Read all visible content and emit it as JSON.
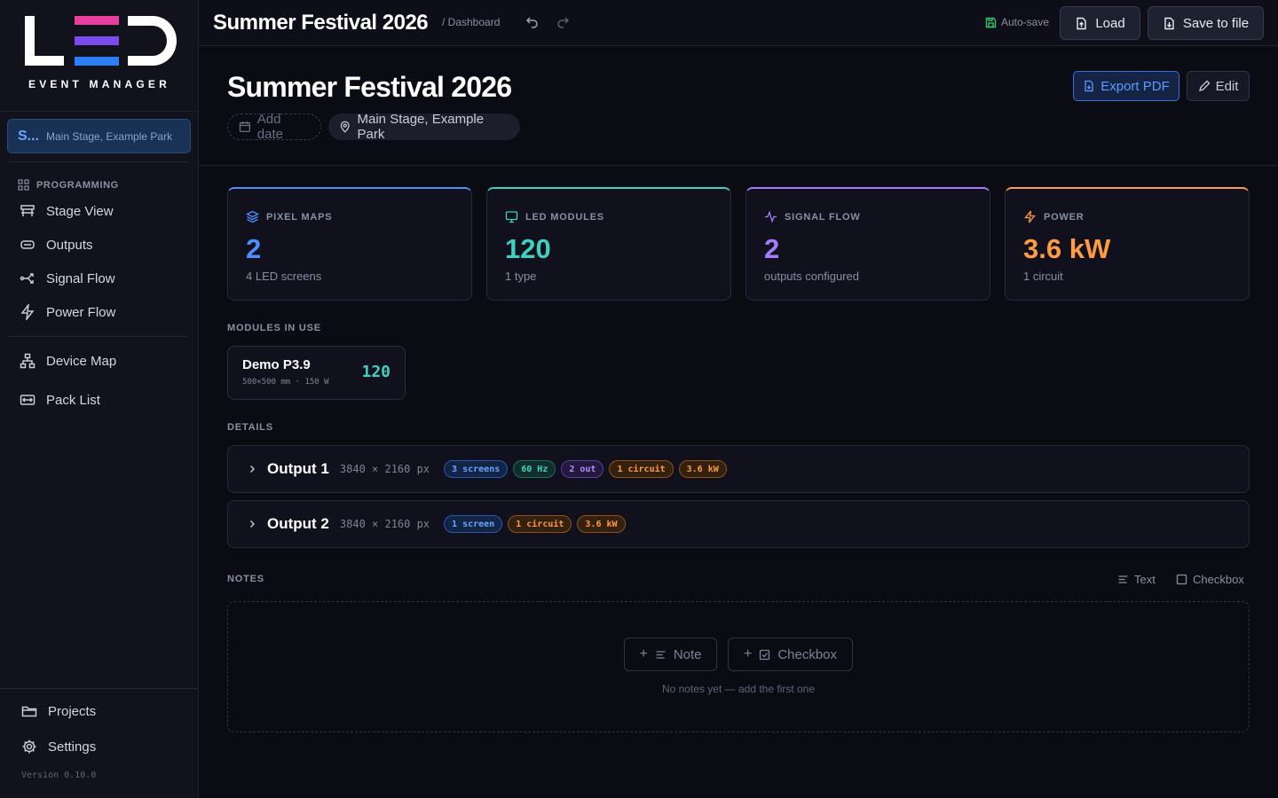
{
  "brand": {
    "logo_text": "LED",
    "subtitle": "EVENT MANAGER"
  },
  "sidebar": {
    "project": {
      "name": "S...",
      "location": "Main Stage, Example Park"
    },
    "section_heading": "PROGRAMMING",
    "items": [
      {
        "label": "Stage View",
        "icon": "stage-icon"
      },
      {
        "label": "Outputs",
        "icon": "outputs-icon"
      },
      {
        "label": "Signal Flow",
        "icon": "signal-flow-icon"
      },
      {
        "label": "Power Flow",
        "icon": "bolt-icon"
      },
      {
        "label": "Device Map",
        "icon": "network-icon"
      },
      {
        "label": "Pack List",
        "icon": "pack-icon"
      }
    ],
    "bottom_items": [
      {
        "label": "Projects",
        "icon": "folder-icon"
      },
      {
        "label": "Settings",
        "icon": "gear-icon"
      }
    ],
    "version": "Version 0.10.0"
  },
  "topbar": {
    "title": "Summer Festival 2026",
    "breadcrumb": "/ Dashboard",
    "autosave": "Auto-save",
    "load": "Load",
    "save": "Save to file"
  },
  "header": {
    "title": "Summer Festival 2026",
    "date_placeholder": "Add date",
    "location": "Main Stage, Example Park",
    "export": "Export PDF",
    "edit": "Edit"
  },
  "stats": [
    {
      "label": "PIXEL MAPS",
      "value": "2",
      "sub": "4 LED screens",
      "color": "#4d8dff"
    },
    {
      "label": "LED MODULES",
      "value": "120",
      "sub": "1 type",
      "color": "#3ed0c0"
    },
    {
      "label": "SIGNAL FLOW",
      "value": "2",
      "sub": "outputs configured",
      "color": "#a77bff"
    },
    {
      "label": "POWER",
      "value": "3.6 kW",
      "sub": "1 circuit",
      "color": "#ff9b42"
    }
  ],
  "modules_section": {
    "label": "MODULES IN USE",
    "module": {
      "name": "Demo P3.9",
      "spec": "500×500 mm · 150 W",
      "count": "120"
    }
  },
  "details_section": {
    "label": "DETAILS",
    "outputs": [
      {
        "name": "Output 1",
        "resolution": "3840 × 2160 px",
        "badges": [
          "3 screens",
          "60 Hz",
          "2 out",
          "1 circuit",
          "3.6 kW"
        ]
      },
      {
        "name": "Output 2",
        "resolution": "3840 × 2160 px",
        "badges": [
          "1 screen",
          "1 circuit",
          "3.6 kW"
        ]
      }
    ]
  },
  "notes_section": {
    "label": "NOTES",
    "tool_text": "Text",
    "tool_checkbox": "Checkbox",
    "add_note": "Note",
    "add_checkbox": "Checkbox",
    "empty": "No notes yet — add the first one"
  }
}
